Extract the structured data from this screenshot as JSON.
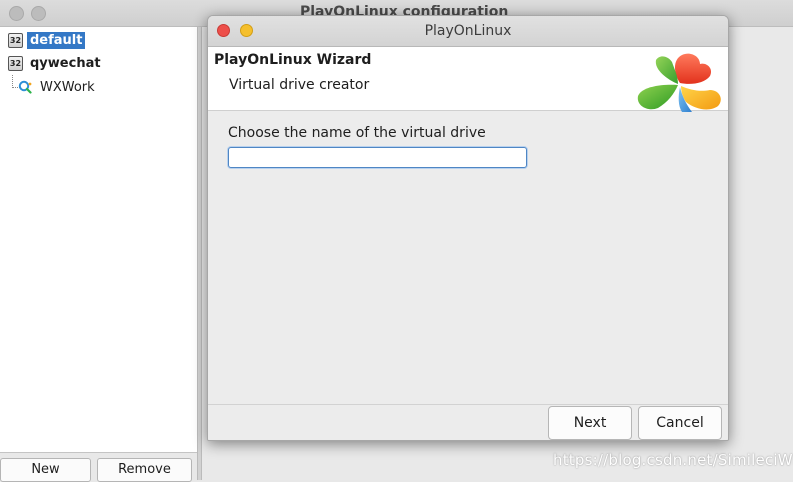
{
  "background_window": {
    "title": "PlayOnLinux configuration",
    "tree": [
      {
        "label": "default",
        "badge": "32",
        "selected": true
      },
      {
        "label": "qywechat",
        "badge": "32",
        "selected": false
      },
      {
        "label": "WXWork",
        "icon": "app-icon",
        "selected": false
      }
    ],
    "buttons": {
      "new": "New",
      "remove": "Remove"
    }
  },
  "dialog": {
    "title": "PlayOnLinux",
    "wizard_title": "PlayOnLinux Wizard",
    "wizard_subtitle": "Virtual drive creator",
    "prompt": "Choose the name of the virtual drive",
    "input_value": "",
    "buttons": {
      "next": "Next",
      "cancel": "Cancel"
    },
    "colors": {
      "close": "#ed4f4a",
      "minimize": "#f5bf2c",
      "accent": "#3478c6"
    }
  },
  "watermark": "https://blog.csdn.net/SimileciWH"
}
